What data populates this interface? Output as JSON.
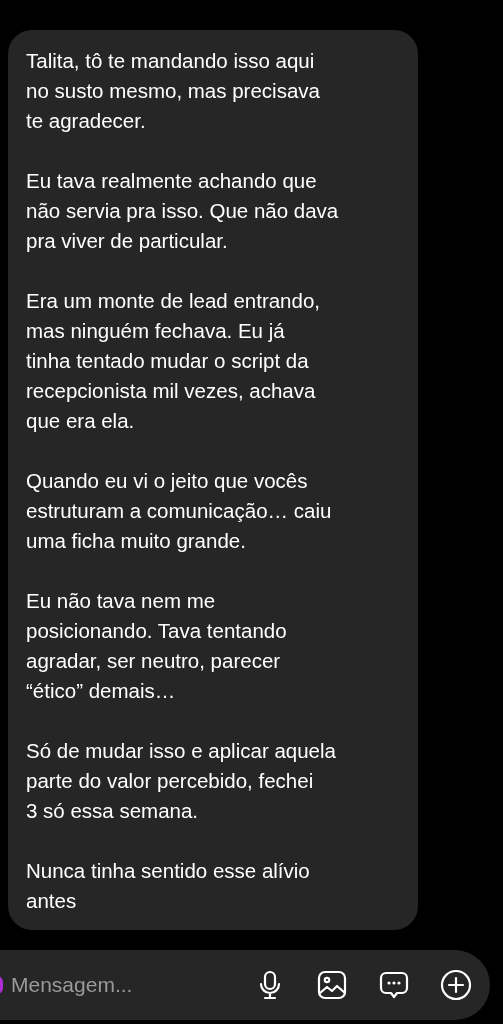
{
  "message": {
    "paragraphs": [
      "Talita, tô te mandando isso aqui\nno susto mesmo, mas precisava\nte agradecer.",
      "Eu tava realmente achando que\nnão servia pra isso. Que não dava\npra viver de particular.",
      "Era um monte de lead entrando,\nmas ninguém fechava. Eu já\ntinha tentado mudar o script da\nrecepcionista mil vezes, achava\nque era ela.",
      "Quando eu vi o jeito que vocês\nestruturam a comunicação… caiu\numa ficha muito grande.",
      "Eu não tava nem me\nposicionando. Tava tentando\nagradar, ser neutro, parecer\n“ético” demais…",
      "Só de mudar isso e aplicar aquela\nparte do valor percebido, fechei\n3 só essa semana.",
      "Nunca tinha sentido esse alívio\nantes"
    ]
  },
  "composer": {
    "placeholder": "Mensagem..."
  }
}
